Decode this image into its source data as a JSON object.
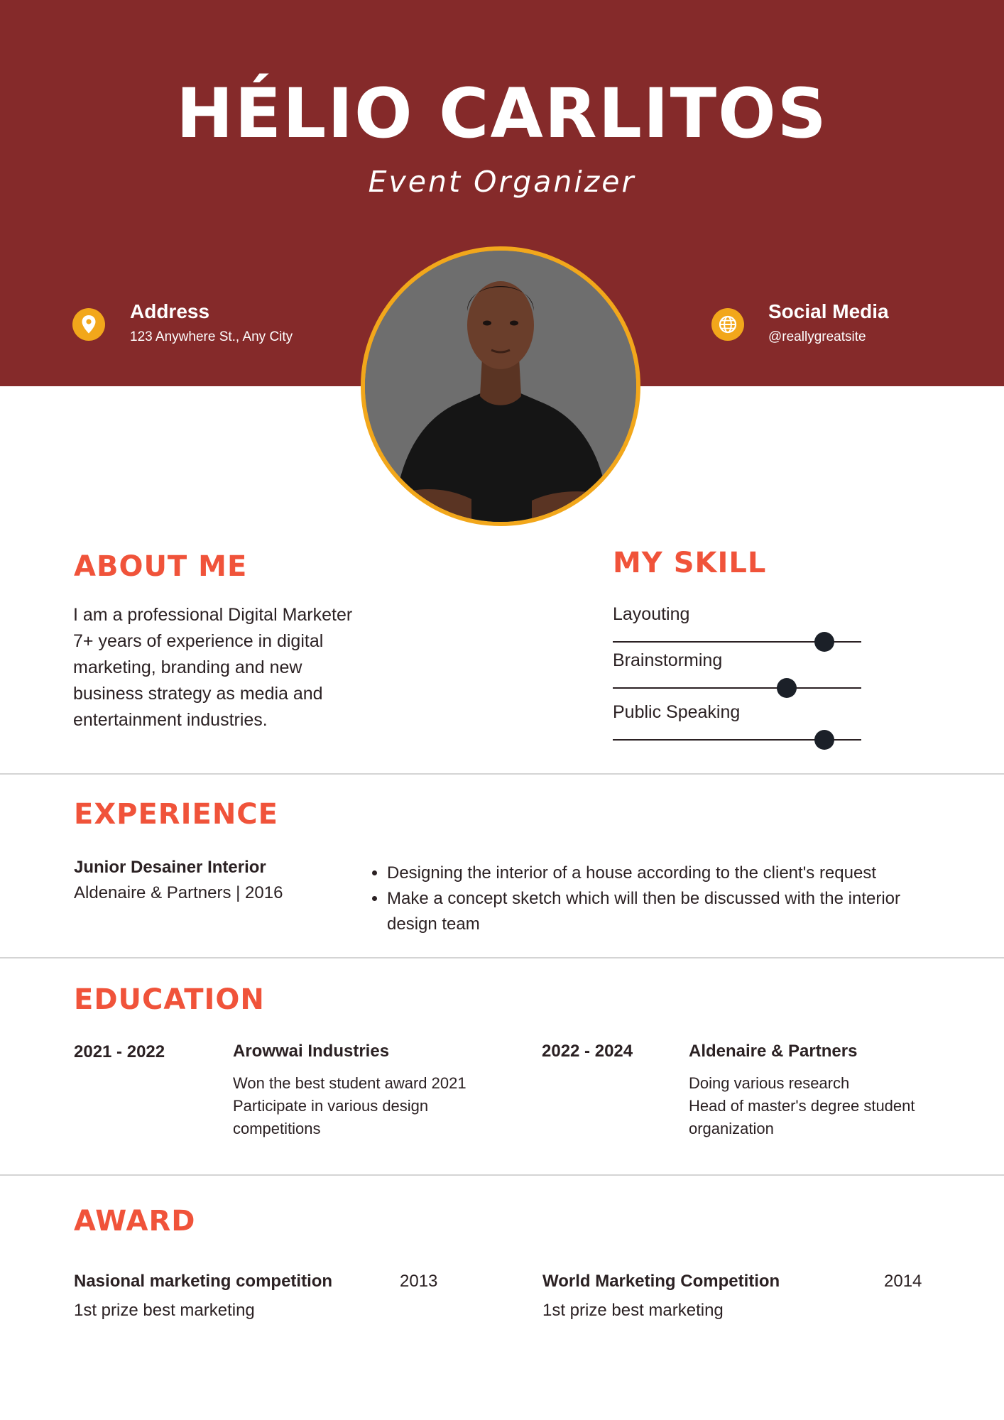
{
  "header": {
    "name": "HÉLIO CARLITOS",
    "role": "Event Organizer",
    "address": {
      "title": "Address",
      "value": "123 Anywhere St., Any City",
      "icon": "location-pin-icon"
    },
    "social": {
      "title": "Social Media",
      "value": "@reallygreatsite",
      "icon": "globe-icon"
    }
  },
  "colors": {
    "header_bg": "#852a2a",
    "accent": "#f0533a",
    "icon_bg": "#f2a71b",
    "photo_ring": "#f2a71b"
  },
  "about": {
    "title": "ABOUT ME",
    "lines": [
      "I am a professional Digital Marketer",
      "7+ years of experience in digital",
      "marketing, branding and new",
      "business strategy as media and",
      "entertainment industries."
    ]
  },
  "skills": {
    "title": "MY SKILL",
    "items": [
      {
        "label": "Layouting",
        "level": 0.85
      },
      {
        "label": "Brainstorming",
        "level": 0.7
      },
      {
        "label": "Public Speaking",
        "level": 0.85
      }
    ]
  },
  "experience": {
    "title": "EXPERIENCE",
    "job_title": "Junior Desainer Interior",
    "company": "Aldenaire & Partners | 2016",
    "bullets": [
      "Designing the interior of a house according to the client's request",
      "Make a concept sketch which will then be discussed with the interior design team"
    ]
  },
  "education": {
    "title": "EDUCATION",
    "entries": [
      {
        "years": "2021 - 2022",
        "school": "Arowwai Industries",
        "desc": [
          "Won the best student award 2021",
          "Participate in various design",
          "competitions"
        ]
      },
      {
        "years": "2022 - 2024",
        "school": "Aldenaire & Partners",
        "desc": [
          "Doing various research",
          "Head of master's degree student",
          "organization"
        ]
      }
    ]
  },
  "award": {
    "title": "AWARD",
    "entries": [
      {
        "name": "Nasional marketing competition",
        "year": "2013",
        "desc": "1st prize best marketing"
      },
      {
        "name": "World Marketing Competition",
        "year": "2014",
        "desc": "1st prize best marketing"
      }
    ]
  }
}
